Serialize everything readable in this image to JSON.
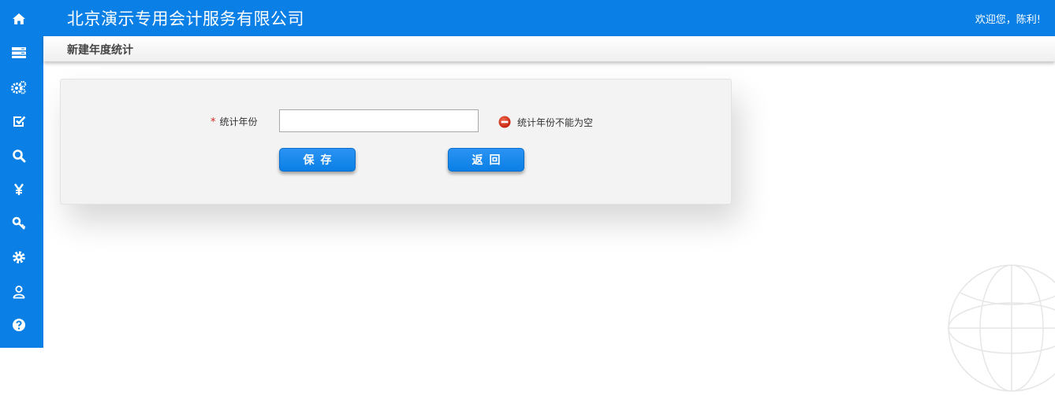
{
  "header": {
    "company_title": "北京演示专用会计服务有限公司",
    "welcome_text": "欢迎您，陈利!"
  },
  "page": {
    "title": "新建年度统计"
  },
  "sidebar": {
    "items": [
      {
        "icon": "home-icon"
      },
      {
        "icon": "server-icon"
      },
      {
        "icon": "gears-icon"
      },
      {
        "icon": "check-square-icon"
      },
      {
        "icon": "search-icon"
      },
      {
        "icon": "yen-icon"
      },
      {
        "icon": "key-icon"
      },
      {
        "icon": "gear-icon"
      },
      {
        "icon": "user-icon"
      },
      {
        "icon": "question-icon"
      }
    ]
  },
  "form": {
    "required_mark": "*",
    "year_label": "统计年份",
    "year_value": "",
    "year_placeholder": "",
    "error_message": "统计年份不能为空",
    "save_label": "保存",
    "back_label": "返回"
  },
  "colors": {
    "primary": "#0a7fe6",
    "error": "#d9251d"
  }
}
